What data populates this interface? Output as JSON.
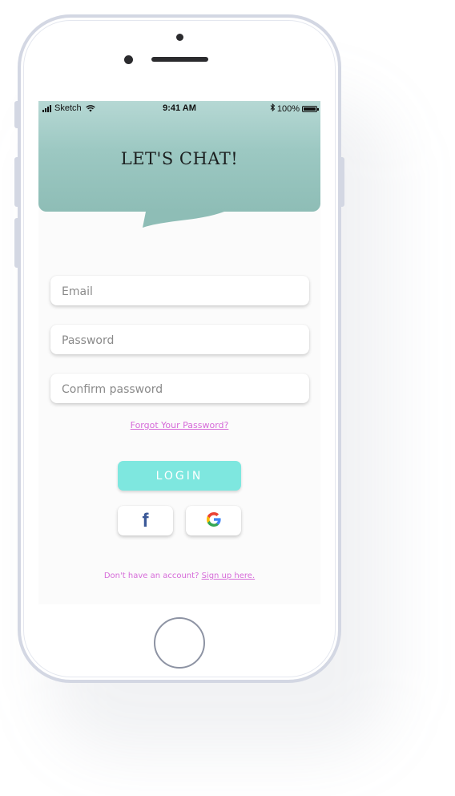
{
  "status_bar": {
    "carrier": "Sketch",
    "time": "9:41 AM",
    "battery": "100%"
  },
  "header": {
    "title": "LET'S CHAT!"
  },
  "form": {
    "email_placeholder": "Email",
    "password_placeholder": "Password",
    "confirm_password_placeholder": "Confirm password",
    "forgot_password_link": "Forgot Your Password?"
  },
  "buttons": {
    "login_label": "LOGIN",
    "facebook_glyph": "f",
    "google_glyph": "G"
  },
  "footer": {
    "signup_prompt": "Don't have an account?",
    "signup_link": "Sign up here."
  },
  "colors": {
    "header_gradient_top": "#b6d8d4",
    "header_gradient_bottom": "#8ebdb6",
    "login_button": "#7ee7df",
    "link_color": "#d66bd9",
    "facebook_blue": "#3b5998"
  },
  "icons": {
    "signal": "cellular-signal-icon",
    "wifi": "wifi-icon",
    "bluetooth": "bluetooth-icon",
    "battery": "battery-icon",
    "facebook": "facebook-icon",
    "google": "google-icon"
  }
}
